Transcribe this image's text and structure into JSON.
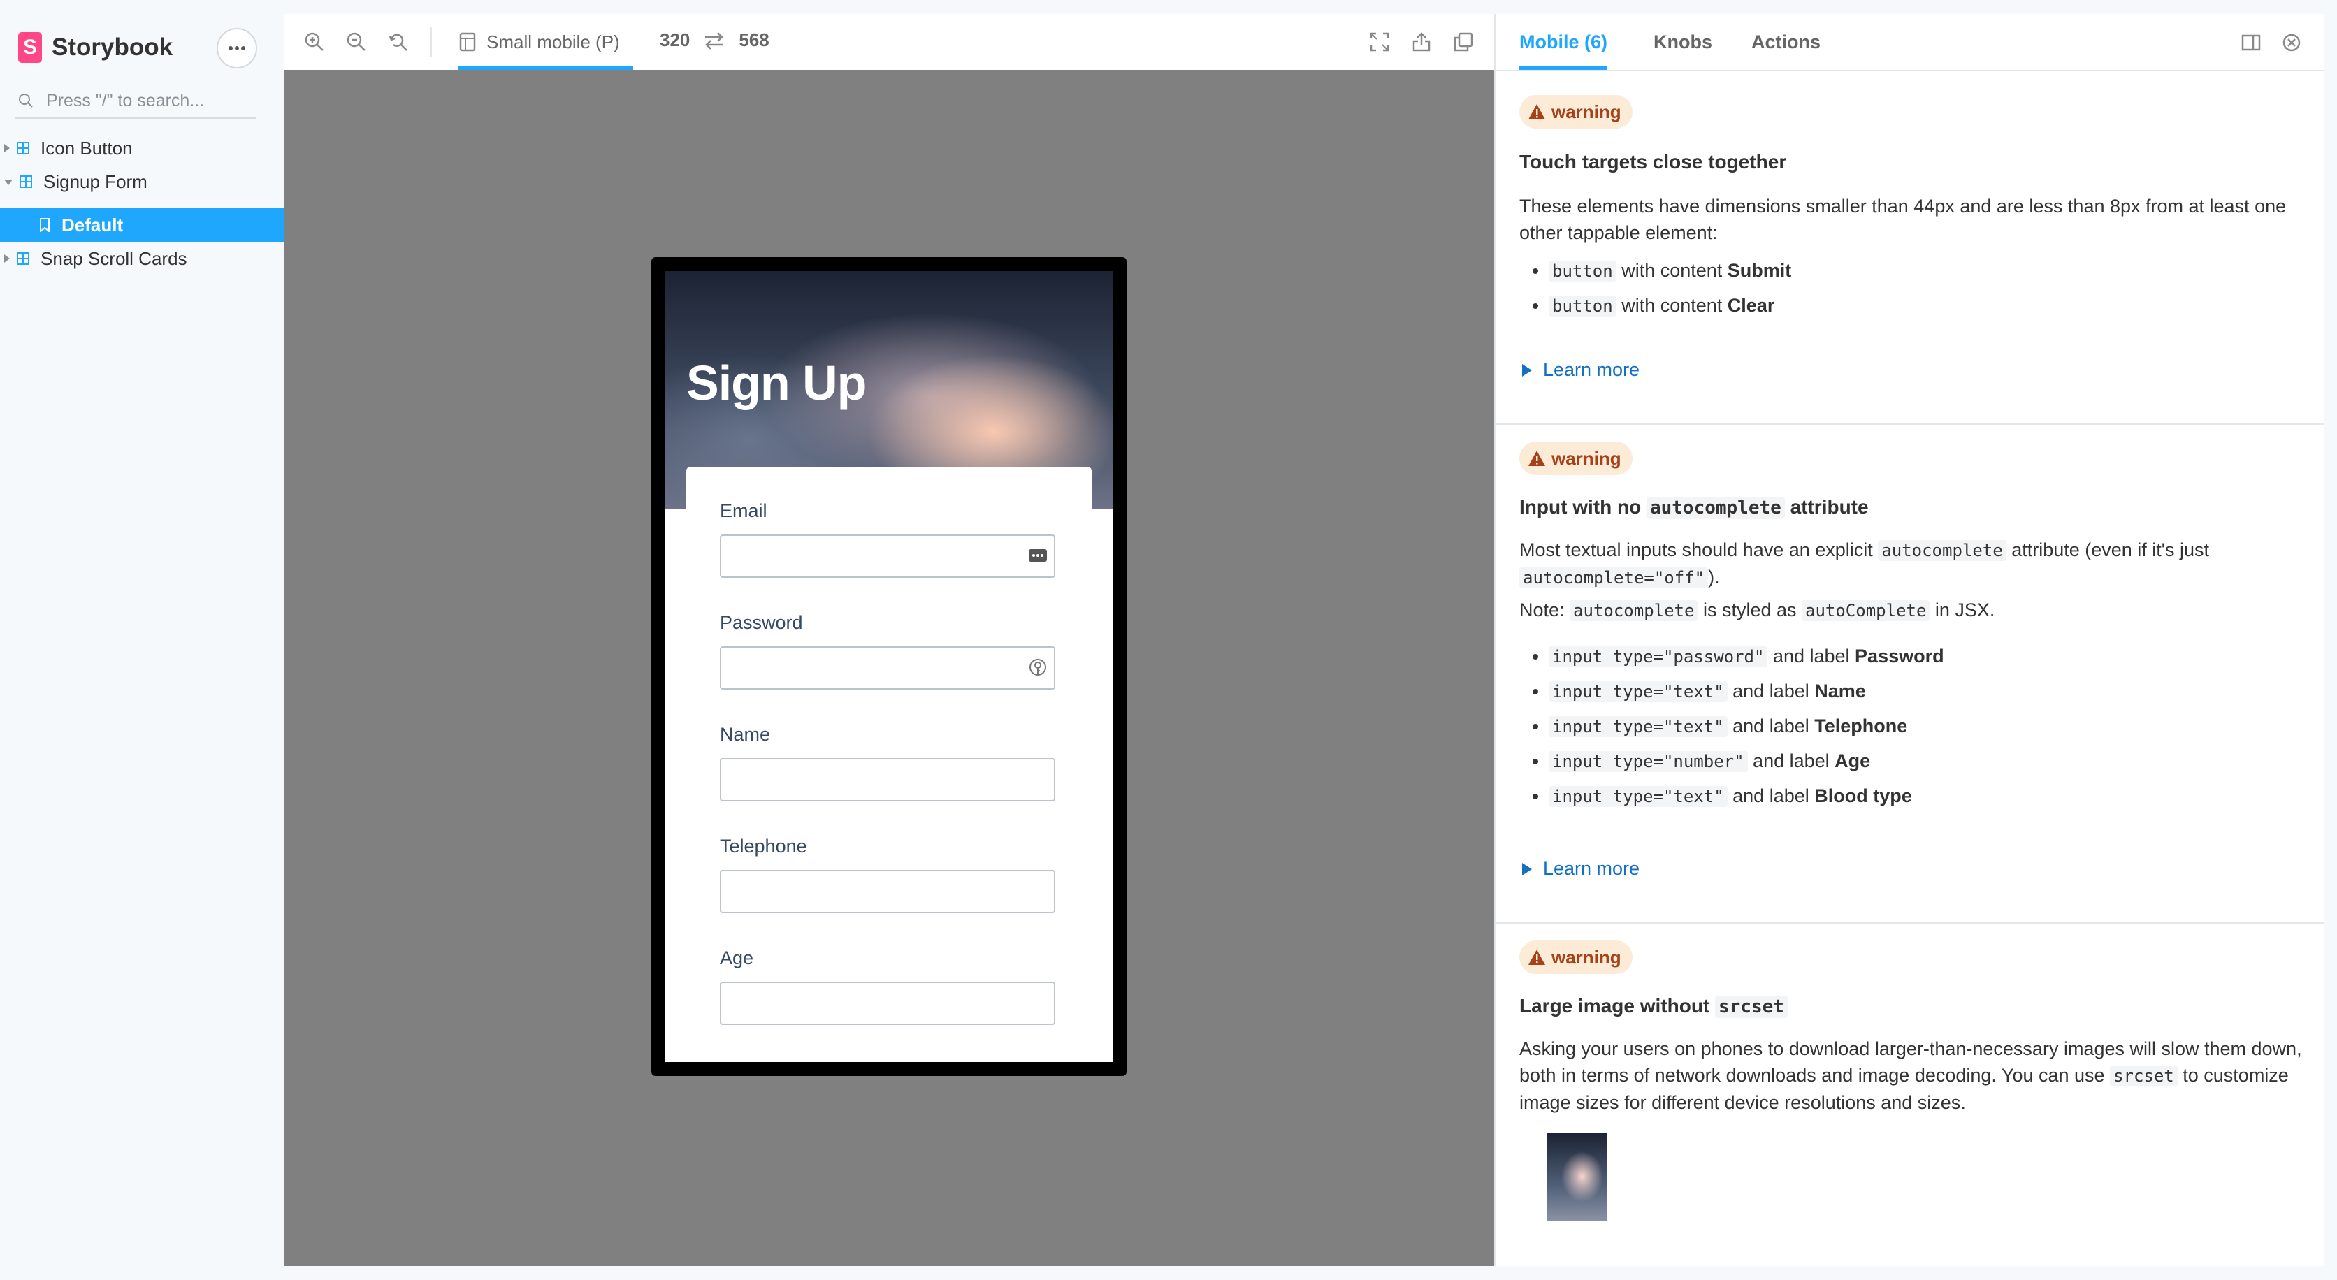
{
  "sidebar": {
    "brand": "Storybook",
    "search_placeholder": "Press \"/\" to search...",
    "tree": [
      {
        "label": "Icon Button"
      },
      {
        "label": "Signup Form"
      },
      {
        "label": "Default"
      },
      {
        "label": "Snap Scroll Cards"
      }
    ]
  },
  "toolbar": {
    "viewport_label": "Small mobile (P)",
    "width": "320",
    "height": "568"
  },
  "preview": {
    "title": "Sign Up",
    "fields": [
      {
        "label": "Email"
      },
      {
        "label": "Password"
      },
      {
        "label": "Name"
      },
      {
        "label": "Telephone"
      },
      {
        "label": "Age"
      }
    ]
  },
  "panel": {
    "tabs": [
      "Mobile (6)",
      "Knobs",
      "Actions"
    ],
    "warnings": [
      {
        "badge": "warning",
        "title": "Touch targets close together",
        "desc": "These elements have dimensions smaller than 44px and are less than 8px from at least one other tappable element:",
        "items": [
          {
            "code": "button",
            "text": " with content ",
            "bold": "Submit"
          },
          {
            "code": "button",
            "text": " with content ",
            "bold": "Clear"
          }
        ],
        "learn": "Learn more"
      },
      {
        "badge": "warning",
        "title_pre": "Input with no ",
        "title_code": "autocomplete",
        "title_post": " attribute",
        "desc_pre": "Most textual inputs should have an explicit ",
        "desc_code1": "autocomplete",
        "desc_mid": " attribute (even if it's just ",
        "desc_code2": "autocomplete=\"off\"",
        "desc_post": ").",
        "note_pre": "Note: ",
        "note_code1": "autocomplete",
        "note_mid": " is styled as ",
        "note_code2": "autoComplete",
        "note_post": " in JSX.",
        "items": [
          {
            "code": "input type=\"password\"",
            "text": " and label ",
            "bold": "Password"
          },
          {
            "code": "input type=\"text\"",
            "text": " and label ",
            "bold": "Name"
          },
          {
            "code": "input type=\"text\"",
            "text": " and label ",
            "bold": "Telephone"
          },
          {
            "code": "input type=\"number\"",
            "text": " and label ",
            "bold": "Age"
          },
          {
            "code": "input type=\"text\"",
            "text": " and label ",
            "bold": "Blood type"
          }
        ],
        "learn": "Learn more"
      },
      {
        "badge": "warning",
        "title_pre": "Large image without ",
        "title_code": "srcset",
        "desc_pre": "Asking your users on phones to download larger-than-necessary images will slow them down, both in terms of network downloads and image decoding. You can use ",
        "desc_code": "srcset",
        "desc_post": " to customize image sizes for different device resolutions and sizes."
      }
    ]
  },
  "colors": {
    "accent": "#1ea7fd",
    "brand": "#ff4785",
    "warning_bg": "#fcebd6",
    "warning_fg": "#a5421a",
    "link": "#1470c4"
  }
}
